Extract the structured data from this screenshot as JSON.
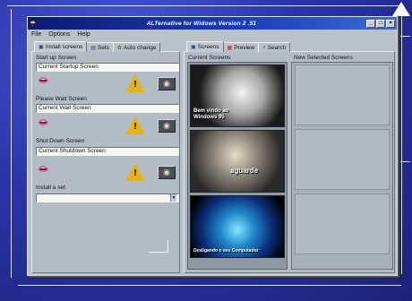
{
  "window": {
    "title": "ALTernative for Widows Version 2 .51",
    "controls": {
      "minimize": "_",
      "maximize": "□",
      "close": "×"
    }
  },
  "menu": [
    "File",
    "Options",
    "Help"
  ],
  "left_tabs": [
    {
      "label": "Install screens",
      "icon": "monitor-icon",
      "active": true
    },
    {
      "label": "Sets",
      "icon": "list-icon",
      "active": false
    },
    {
      "label": "Auto change",
      "icon": "refresh-icon",
      "active": false
    }
  ],
  "install": {
    "startup": {
      "label": "Start up Screen",
      "value": "Current Startup Screen"
    },
    "wait": {
      "label": "Please Wait Screen",
      "value": "Current Wait Screen"
    },
    "shutdown": {
      "label": "Shut Down Screen",
      "value": "Current Shutdown Screen"
    },
    "set": {
      "label": "Install a set",
      "value": ""
    }
  },
  "right_tabs": [
    {
      "label": "Screens",
      "icon": "monitor-icon",
      "active": true
    },
    {
      "label": "Preview",
      "icon": "preview-icon",
      "active": false
    },
    {
      "label": "Search",
      "icon": "search-icon",
      "active": false
    }
  ],
  "screens": {
    "current_header": "Current Screens",
    "new_header": "New Selected Screens",
    "thumbnails": [
      {
        "caption": "Bem vindo ao Windows 95"
      },
      {
        "caption": "aguarde"
      },
      {
        "caption": "Desligando o seu Computador"
      }
    ]
  },
  "colors": {
    "titlebar": "#0b1a73",
    "window_face": "#b9c1c9",
    "background": "#2a34a8",
    "warning": "#e6b11a"
  }
}
